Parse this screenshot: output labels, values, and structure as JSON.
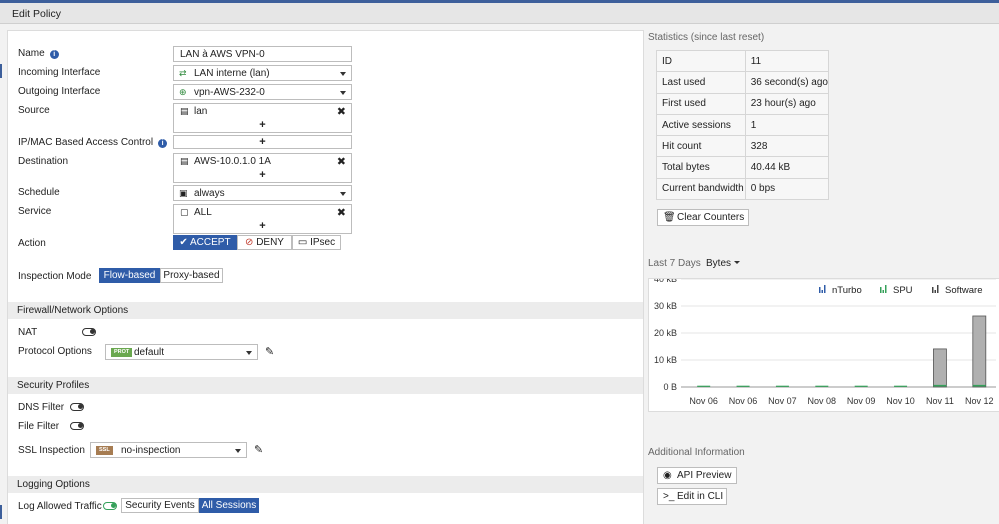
{
  "window": {
    "title": "Edit Policy"
  },
  "form": {
    "name_label": "Name",
    "name_value": "LAN à AWS VPN-0",
    "incoming_label": "Incoming Interface",
    "incoming_value": "LAN interne (lan)",
    "outgoing_label": "Outgoing Interface",
    "outgoing_value": "vpn-AWS-232-0",
    "source_label": "Source",
    "source_value": "lan",
    "ipmac_label": "IP/MAC Based Access Control",
    "destination_label": "Destination",
    "destination_value": "AWS-10.0.1.0 1A",
    "schedule_label": "Schedule",
    "schedule_value": "always",
    "service_label": "Service",
    "service_value": "ALL",
    "action_label": "Action",
    "action_accept": "ACCEPT",
    "action_deny": "DENY",
    "action_ipsec": "IPsec",
    "inspection_label": "Inspection Mode",
    "inspection_flow": "Flow-based",
    "inspection_proxy": "Proxy-based"
  },
  "firewall": {
    "title": "Firewall/Network Options",
    "nat_label": "NAT",
    "protocol_label": "Protocol Options",
    "protocol_badge": "PROT",
    "protocol_value": "default"
  },
  "security": {
    "title": "Security Profiles",
    "dns_label": "DNS Filter",
    "file_label": "File Filter",
    "ssl_label": "SSL Inspection",
    "ssl_badge": "SSL",
    "ssl_value": "no-inspection"
  },
  "logging": {
    "title": "Logging Options",
    "allowed_label": "Log Allowed Traffic",
    "security_events": "Security Events",
    "all_sessions": "All Sessions"
  },
  "stats": {
    "title": "Statistics (since last reset)",
    "rows": [
      {
        "label": "ID",
        "value": "11"
      },
      {
        "label": "Last used",
        "value": "36 second(s) ago"
      },
      {
        "label": "First used",
        "value": "23 hour(s) ago"
      },
      {
        "label": "Active sessions",
        "value": "1"
      },
      {
        "label": "Hit count",
        "value": "328"
      },
      {
        "label": "Total bytes",
        "value": "40.44 kB"
      },
      {
        "label": "Current bandwidth",
        "value": "0 bps"
      }
    ],
    "clear_button": "Clear Counters"
  },
  "chart_header": {
    "period": "Last 7 Days",
    "metric": "Bytes"
  },
  "chart_data": {
    "type": "bar",
    "categories": [
      "Nov 06",
      "Nov 06",
      "Nov 07",
      "Nov 08",
      "Nov 09",
      "Nov 10",
      "Nov 11",
      "Nov 12"
    ],
    "series": [
      {
        "name": "nTurbo",
        "values": [
          0,
          0,
          0,
          0,
          0,
          0,
          0,
          0
        ]
      },
      {
        "name": "SPU",
        "values": [
          0.3,
          0.3,
          0.3,
          0.3,
          0.3,
          0.3,
          0.6,
          0.6
        ]
      },
      {
        "name": "Software",
        "values": [
          0,
          0,
          0,
          0,
          0,
          0,
          13.5,
          25.7
        ]
      }
    ],
    "yticks": [
      "0 B",
      "10 kB",
      "20 kB",
      "30 kB",
      "40 kB"
    ],
    "ylim": [
      0,
      40
    ],
    "legend": "top-right",
    "colors": {
      "nTurbo": "#2f5ca8",
      "SPU": "#35a05a",
      "Software": "#444444",
      "bar_fill": "#b0b0b0"
    }
  },
  "additional": {
    "title": "Additional Information",
    "api_preview": "API Preview",
    "edit_cli": "Edit in CLI"
  }
}
